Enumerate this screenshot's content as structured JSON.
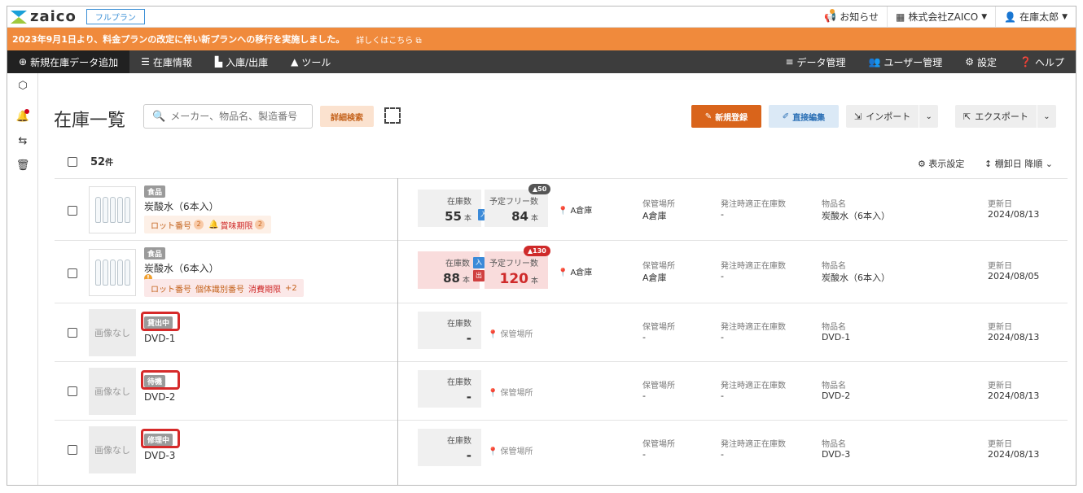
{
  "topbar": {
    "brand": "zaico",
    "plan": "フルプラン",
    "notice": "お知らせ",
    "company": "株式会社ZAICO",
    "user": "在庫太郎"
  },
  "announcement": {
    "text": "2023年9月1日より、料金プランの改定に伴い新プランへの移行を実施しました。",
    "link": "詳しくはこちら"
  },
  "nav": {
    "left": [
      "新規在庫データ追加",
      "在庫情報",
      "入庫/出庫",
      "ツール"
    ],
    "right": [
      "データ管理",
      "ユーザー管理",
      "設定",
      "ヘルプ"
    ]
  },
  "header": {
    "title": "在庫一覧",
    "search_placeholder": "メーカー、物品名、製造番号",
    "advanced_search": "詳細検索",
    "new_button": "新規登録",
    "direct_edit": "直接編集",
    "import": "インポート",
    "export": "エクスポート",
    "count": "52",
    "count_unit": "件",
    "display_settings": "表示設定",
    "sort": "棚卸日 降順"
  },
  "labels": {
    "stock": "在庫数",
    "free_stock": "予定フリー数",
    "location": "保管場所",
    "reorder_point": "発注時適正在庫数",
    "item_name": "物品名",
    "updated": "更新日",
    "no_image": "画像なし",
    "location_placeholder": "保管場所",
    "dash": "-",
    "in": "入",
    "out": "出"
  },
  "rows": [
    {
      "category": "食品",
      "name": "炭酸水（6本入）",
      "tags": [
        {
          "text": "ロット番号",
          "count": "2"
        },
        {
          "text": "賞味期限",
          "count": "2"
        }
      ],
      "stock": "55",
      "unit": "本",
      "free": "84",
      "free_pill": "▲50",
      "location": "A倉庫",
      "location_field": "A倉庫",
      "reorder": "-",
      "item_name": "炭酸水（6本入）",
      "updated": "2024/08/13"
    },
    {
      "category": "食品",
      "name": "炭酸水（6本入）",
      "tags": [
        {
          "text": "ロット番号"
        },
        {
          "text": "個体識別番号"
        },
        {
          "text": "消費期限"
        },
        {
          "text": "+2"
        }
      ],
      "stock": "88",
      "unit": "本",
      "free": "120",
      "free_pill": "▲130",
      "location": "A倉庫",
      "location_field": "A倉庫",
      "reorder": "-",
      "item_name": "炭酸水（6本入）",
      "updated": "2024/08/05"
    },
    {
      "category": "貸出中",
      "name": "DVD-1",
      "stock": "-",
      "location_field": "-",
      "reorder": "-",
      "item_name": "DVD-1",
      "updated": "2024/08/13"
    },
    {
      "category": "待機",
      "name": "DVD-2",
      "stock": "-",
      "location_field": "-",
      "reorder": "-",
      "item_name": "DVD-2",
      "updated": "2024/08/13"
    },
    {
      "category": "修理中",
      "name": "DVD-3",
      "stock": "-",
      "location_field": "-",
      "reorder": "-",
      "item_name": "DVD-3",
      "updated": "2024/08/13"
    }
  ]
}
